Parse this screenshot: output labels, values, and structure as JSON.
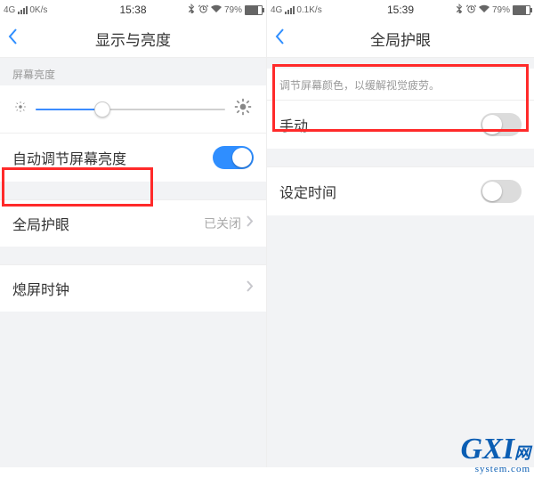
{
  "left": {
    "status": {
      "network": "4G",
      "speed": "0K/s",
      "time": "15:38",
      "battery_pct": "79%"
    },
    "nav_title": "显示与亮度",
    "brightness_label": "屏幕亮度",
    "auto_brightness_label": "自动调节屏幕亮度",
    "auto_brightness_on": true,
    "eye_care_label": "全局护眼",
    "eye_care_value": "已关闭",
    "screen_clock_label": "熄屏时钟"
  },
  "right": {
    "status": {
      "network": "4G",
      "speed": "0.1K/s",
      "time": "15:39",
      "battery_pct": "79%"
    },
    "nav_title": "全局护眼",
    "hint_text": "调节屏幕颜色，以缓解视觉疲劳。",
    "manual_label": "手动",
    "manual_on": false,
    "schedule_label": "设定时间",
    "schedule_on": false
  },
  "watermark": {
    "brand": "GXI",
    "suffix": "网",
    "sub": "system.com"
  }
}
